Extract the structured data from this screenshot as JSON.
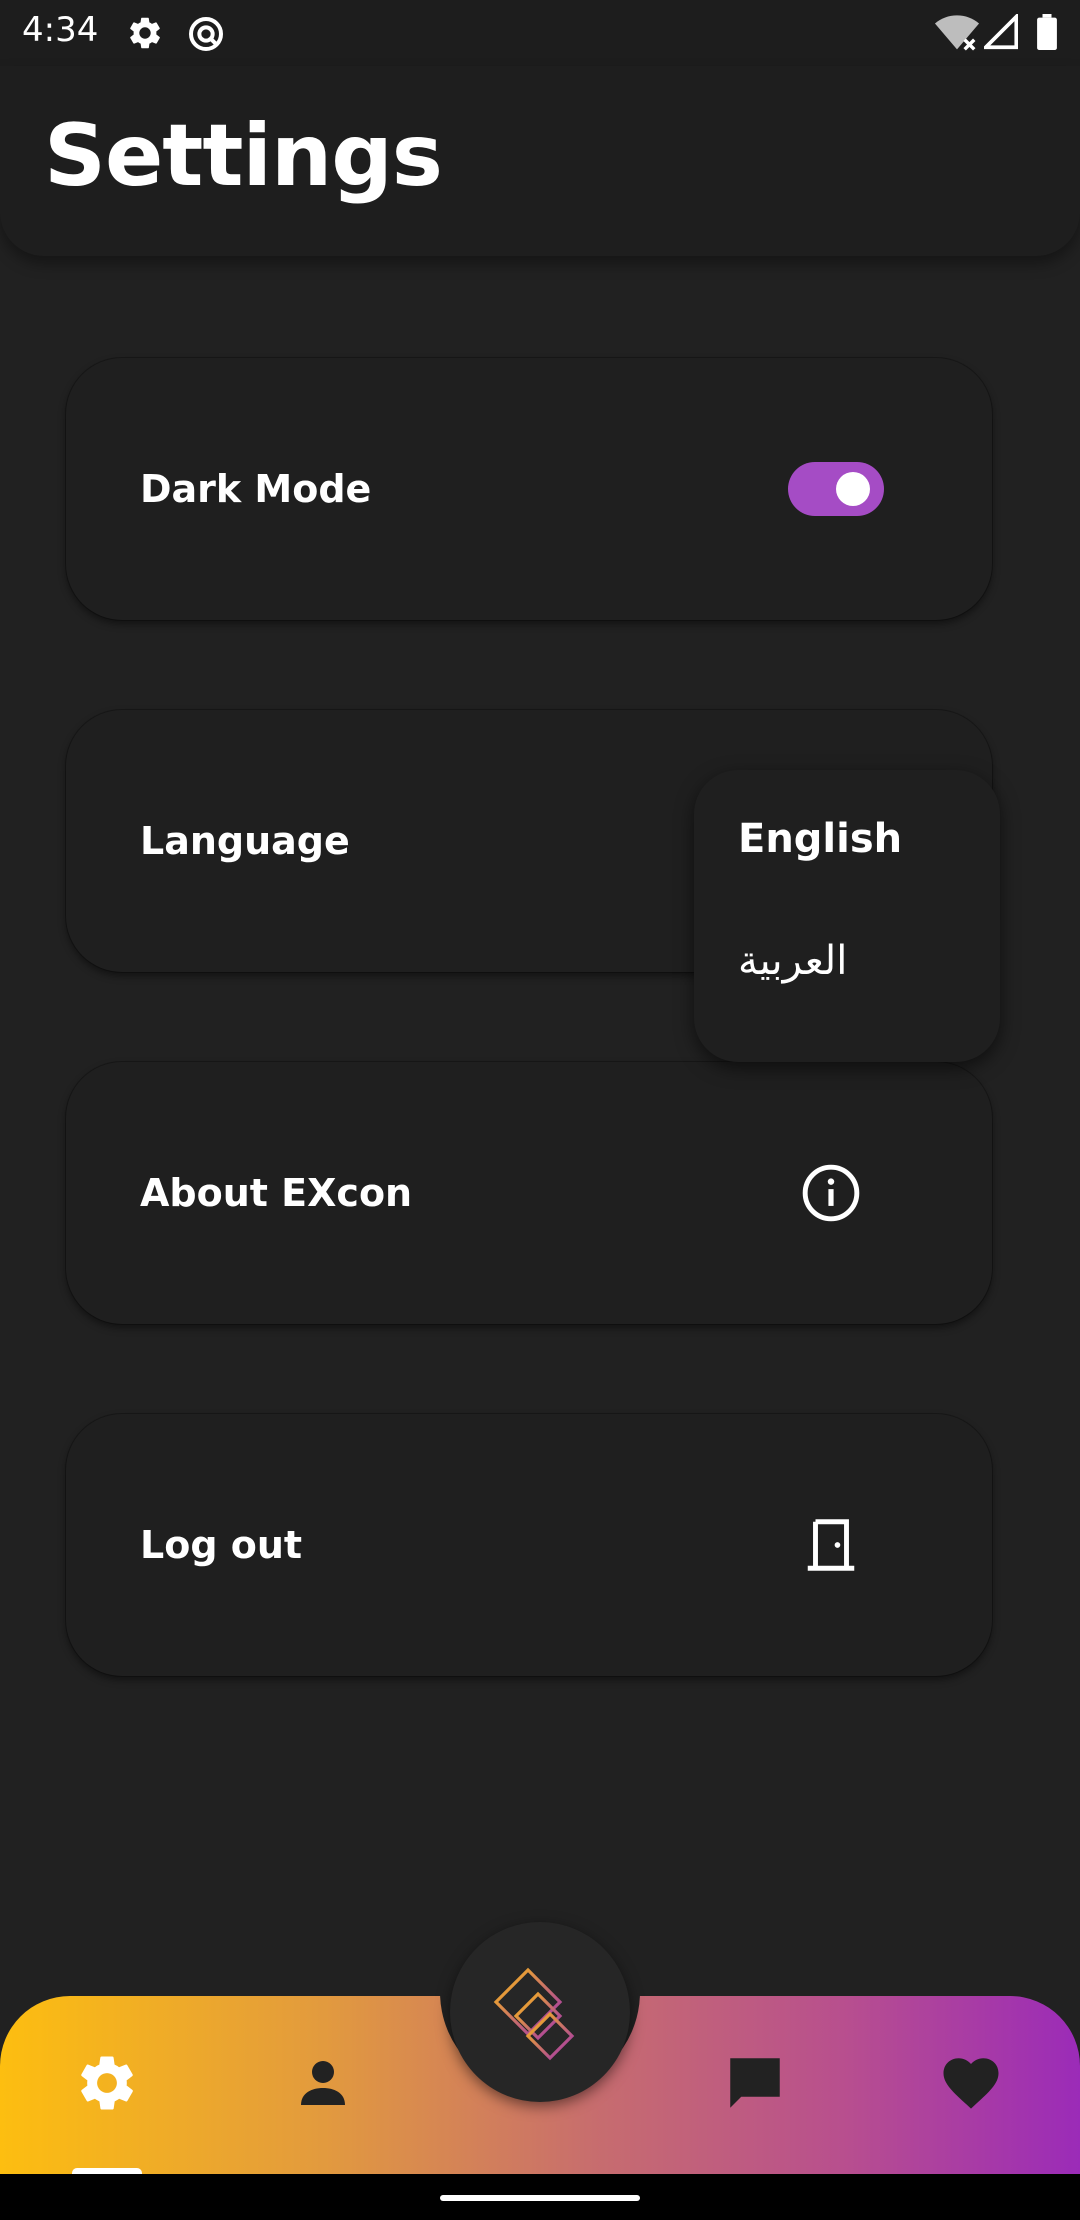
{
  "status_bar": {
    "time": "4:34",
    "icons": [
      "settings-gear-icon",
      "do-not-disturb-icon",
      "wifi-no-internet-icon",
      "cell-signal-icon",
      "battery-icon"
    ]
  },
  "header": {
    "title": "Settings"
  },
  "settings": {
    "dark_mode": {
      "label": "Dark Mode",
      "enabled": true,
      "accent": "#a54cc5"
    },
    "language": {
      "label": "Language"
    },
    "about": {
      "label": "About EXcon",
      "icon": "info-icon"
    },
    "logout": {
      "label": "Log out",
      "icon": "door-icon"
    }
  },
  "language_menu": {
    "options": [
      {
        "label": "English",
        "selected": true
      },
      {
        "label": "العربية",
        "selected": false
      }
    ]
  },
  "bottom_nav": {
    "items": [
      {
        "icon": "settings-icon",
        "active": true
      },
      {
        "icon": "person-icon",
        "active": false
      },
      {
        "icon": "home-logo-icon",
        "active": false
      },
      {
        "icon": "chat-icon",
        "active": false
      },
      {
        "icon": "heart-icon",
        "active": false
      }
    ],
    "gradient": [
      "#fdbe10",
      "#9b2bb8"
    ]
  }
}
